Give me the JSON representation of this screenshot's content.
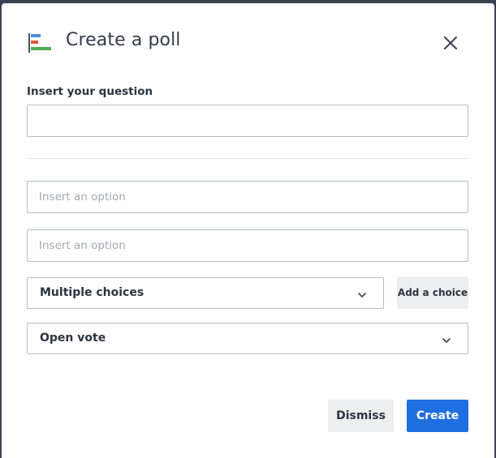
{
  "dialog": {
    "title": "Create a poll",
    "icon": "poll-icon",
    "close_icon": "close-icon"
  },
  "question": {
    "label": "Insert your question",
    "value": ""
  },
  "options": [
    {
      "placeholder": "Insert an option",
      "value": ""
    },
    {
      "placeholder": "Insert an option",
      "value": ""
    }
  ],
  "choice_type": {
    "selected": "Multiple choices",
    "icon": "chevron-down-icon"
  },
  "add_choice_label": "Add a choice",
  "vote_type": {
    "selected": "Open vote",
    "icon": "chevron-down-icon"
  },
  "actions": {
    "dismiss_label": "Dismiss",
    "create_label": "Create"
  },
  "colors": {
    "primary": "#1e6fe0",
    "secondary_bg": "#eceef0",
    "backdrop": "#3a4250"
  }
}
